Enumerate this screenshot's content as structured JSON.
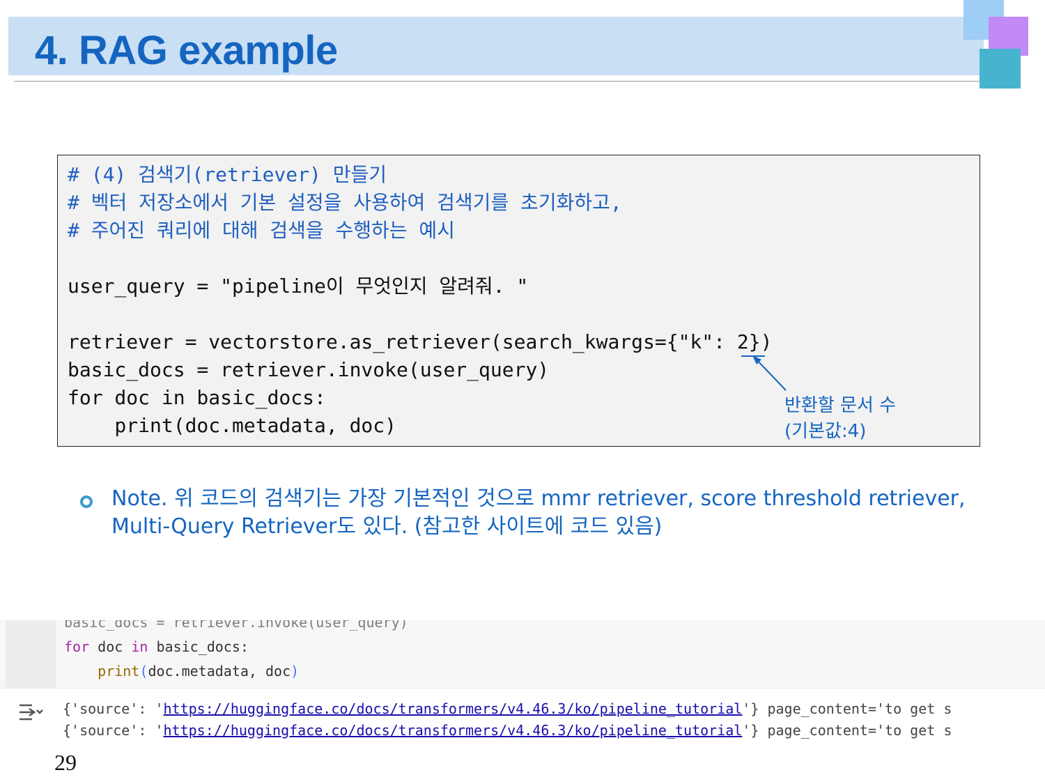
{
  "slide": {
    "title": "4. RAG example",
    "page_number": "29"
  },
  "code_box": {
    "lines": [
      "# (4) 검색기(retriever) 만들기",
      "# 벡터 저장소에서 기본 설정을 사용하여 검색기를 초기화하고,",
      "# 주어진 쿼리에 대해 검색을 수행하는 예시",
      "",
      "user_query = \"pipeline이 무엇인지 알려줘. \"",
      "",
      "retriever = vectorstore.as_retriever(search_kwargs={\"k\": 2})",
      "basic_docs = retriever.invoke(user_query)",
      "for doc in basic_docs:",
      "    print(doc.metadata, doc)"
    ],
    "annotation_line1": "반환할 문서 수",
    "annotation_line2": "(기본값:4)"
  },
  "note": {
    "text": "Note. 위 코드의 검색기는 가장 기본적인 것으로 mmr retriever, score threshold retriever, Multi-Query Retriever도 있다. (참고한 사이트에 코드 있음)"
  },
  "notebook": {
    "cut_line": "basic_docs = retriever.invoke(user_query)",
    "code_kw_for": "for",
    "code_mid1": " doc ",
    "code_kw_in": "in",
    "code_mid2": " basic_docs:",
    "code_indent": "    ",
    "code_fn": "print",
    "code_open": "(",
    "code_args": "doc.metadata, doc",
    "code_close": ")",
    "output": [
      {
        "prefix": "{'source': '",
        "url": "https://huggingface.co/docs/transformers/v4.46.3/ko/pipeline_tutorial",
        "suffix": "'} page_content='to get s"
      },
      {
        "prefix": "{'source': '",
        "url": "https://huggingface.co/docs/transformers/v4.46.3/ko/pipeline_tutorial",
        "suffix": "'} page_content='to get s"
      }
    ],
    "output_icon": "output-toggle-icon"
  },
  "colors": {
    "title": "#1565c0",
    "title_band": "#c9dff4",
    "comment": "#1f5fbf",
    "annotation": "#1565c0",
    "deco_blue": "#9ecdf5",
    "deco_purple": "#c389f5",
    "deco_teal": "#46b3cf"
  }
}
